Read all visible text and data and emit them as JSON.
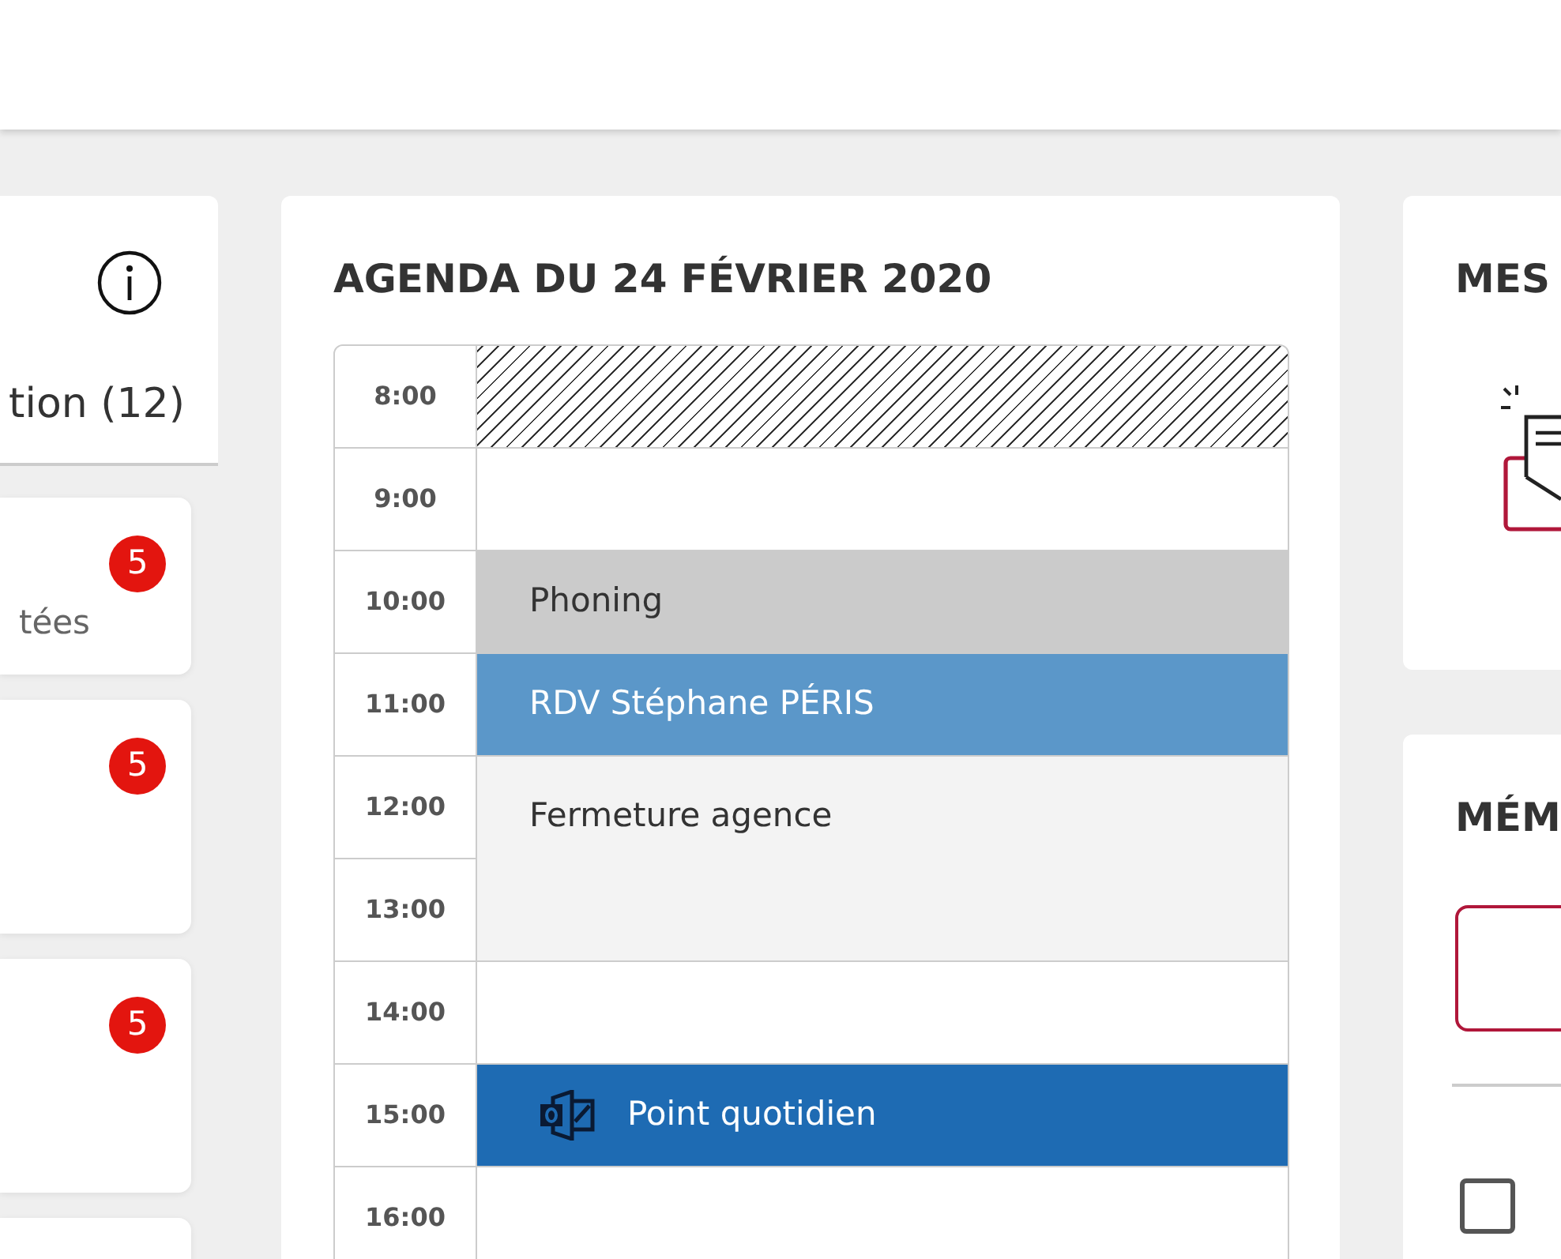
{
  "left_panel": {
    "tab_label": "tion (12)",
    "cards": [
      {
        "kind": "notification",
        "badge": "5",
        "text": "tées"
      },
      {
        "kind": "notification",
        "badge": "5"
      },
      {
        "kind": "notification",
        "badge": "5"
      },
      {
        "kind": "notification"
      }
    ]
  },
  "agenda": {
    "title": "AGENDA DU 24 FÉVRIER 2020",
    "rows": [
      {
        "time": "8:00",
        "kind": "blocked"
      },
      {
        "time": "9:00",
        "kind": "free"
      },
      {
        "time": "10:00",
        "kind": "task",
        "label": "Phoning"
      },
      {
        "time": "11:00",
        "kind": "appointment",
        "label": "RDV Stéphane PÉRIS"
      },
      {
        "time": "12:00",
        "kind": "closure",
        "label": "Fermeture agence"
      },
      {
        "time": "13:00",
        "kind": "closure"
      },
      {
        "time": "14:00",
        "kind": "free"
      },
      {
        "time": "15:00",
        "kind": "meeting",
        "label": "Point quotidien"
      },
      {
        "time": "16:00",
        "kind": "free"
      }
    ]
  },
  "messages_card": {
    "title": "MES"
  },
  "memo_card": {
    "title": "MÉM",
    "checkbox": {
      "checked": false
    }
  }
}
